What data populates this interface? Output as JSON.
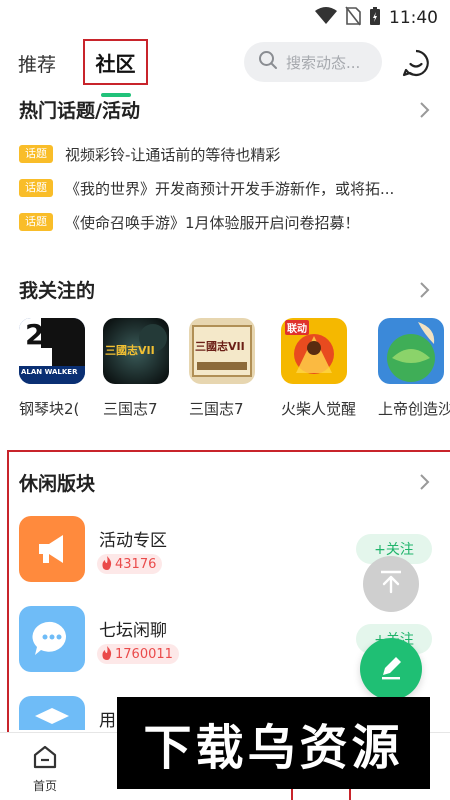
{
  "status_bar": {
    "time": "11:40",
    "icons": [
      "wifi-icon",
      "no-sim-icon",
      "battery-charging-icon"
    ]
  },
  "header": {
    "tabs": [
      {
        "label": "推荐",
        "active": false
      },
      {
        "label": "社区",
        "active": true
      }
    ],
    "search_placeholder": "搜索动态...",
    "message_icon": "message-icon"
  },
  "hot_topics": {
    "title": "热门话题/活动",
    "tag_label": "话题",
    "items": [
      "视频彩铃-让通话前的等待也精彩",
      "《我的世界》开发商预计开发手游新作，或将拓...",
      "《使命召唤手游》1月体验服开启问卷招募！"
    ]
  },
  "following": {
    "title": "我关注的",
    "games": [
      {
        "name": "钢琴块2(",
        "icon": "piano-tiles-icon",
        "badge": "ALAN WALKER",
        "num": "2"
      },
      {
        "name": "三国志7",
        "icon": "sanguozhi-icon",
        "badge": "三國志VII"
      },
      {
        "name": "三国志7",
        "icon": "sanguozhi-scroll-icon",
        "badge": "三國志VII"
      },
      {
        "name": "火柴人觉醒",
        "icon": "stickman-icon",
        "badge": "联动"
      },
      {
        "name": "上帝创造沙",
        "icon": "god-sandbox-icon"
      }
    ]
  },
  "leisure": {
    "title": "休闲版块",
    "boards": [
      {
        "name": "活动专区",
        "heat": "43176",
        "icon": "megaphone-icon",
        "color": "#ff8a3d",
        "follow": "+关注"
      },
      {
        "name": "七坛闲聊",
        "heat": "1760011",
        "icon": "chat-bubble-icon",
        "color": "#6fbcf7",
        "follow": "+关注"
      },
      {
        "name": "用",
        "icon": "graduation-cap-icon",
        "color": "#6fbcf7"
      }
    ]
  },
  "bottom_nav": {
    "items": [
      {
        "label": "首页",
        "icon": "home-icon"
      }
    ]
  },
  "watermark": "下载乌资源",
  "colors": {
    "accent_green": "#21c27a",
    "tag_yellow": "#f9bd29",
    "heat_red": "#ea4b4b",
    "highlight_red": "#c8242b"
  }
}
